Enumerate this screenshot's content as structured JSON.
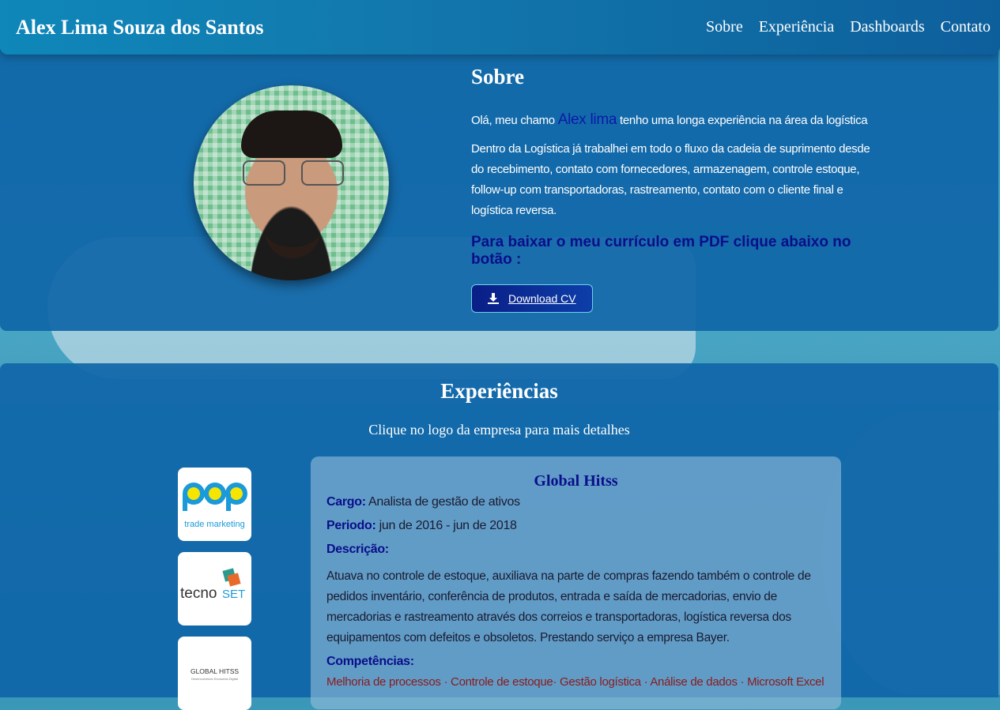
{
  "header": {
    "site_title": "Alex Lima Souza dos Santos",
    "nav": [
      "Sobre",
      "Experiência",
      "Dashboards",
      "Contato"
    ]
  },
  "about": {
    "title": "Sobre",
    "intro_prefix": "Olá, meu chamo",
    "intro_name": "Alex lima",
    "intro_suffix": "tenho uma longa experiência na área da logística",
    "paragraph": "Dentro da Logística já trabalhei em todo o fluxo da cadeia de suprimento desde do recebimento, contato com fornecedores, armazenagem, controle estoque, follow-up com transportadoras, rastreamento, contato com o cliente final e logística reversa.",
    "cv_label": "Para baixar o meu currículo em PDF clique abaixo no botão :",
    "download_label": "Download CV"
  },
  "experience": {
    "title": "Experiências",
    "subtitle": "Clique no logo da empresa para mais detalhes",
    "logos": [
      {
        "name": "pop trade marketing",
        "line1": "pop",
        "line2": "trade marketing"
      },
      {
        "name": "tecnoSET",
        "text_a": "tecno",
        "text_b": "SET"
      },
      {
        "name": "GLOBAL HITSS",
        "line1": "GLOBAL HITSS",
        "line2": "Desenvolvendo Economia Digital"
      }
    ],
    "detail": {
      "company": "Global Hitss",
      "cargo_label": "Cargo:",
      "cargo": "Analista de gestão de ativos",
      "periodo_label": "Periodo:",
      "periodo": "jun de 2016 - jun de 2018",
      "descricao_label": "Descrição:",
      "descricao": "Atuava no controle de estoque, auxiliava na parte de compras fazendo também o controle de pedidos inventário, conferência de produtos, entrada e saída de mercadorias, envio de mercadorias e rastreamento através dos correios e transportadoras, logística reversa dos equipamentos com defeitos e obsoletos. Prestando serviço a empresa Bayer.",
      "competencias_label": "Competências:",
      "competencias": "Melhoria de processos · Controle de estoque· Gestão logística · Análise de dados · Microsoft Excel"
    }
  },
  "colors": {
    "accent": "#0a0e8a",
    "header": "#1278ad",
    "skills": "#8b1a1a"
  }
}
